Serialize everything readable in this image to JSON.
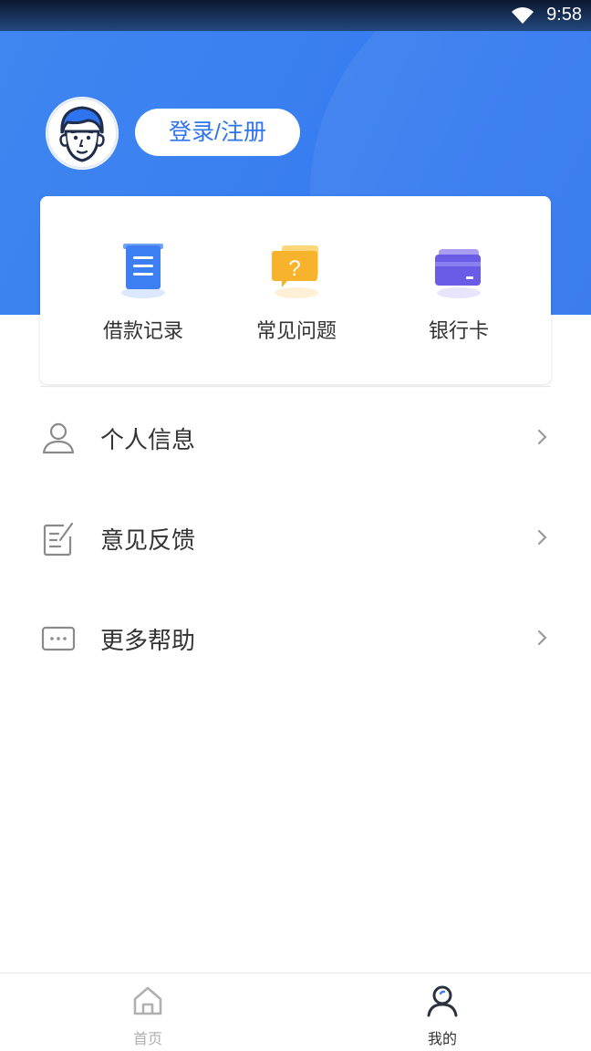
{
  "status_bar": {
    "time": "9:58"
  },
  "profile": {
    "login_label": "登录/注册"
  },
  "quick_actions": [
    {
      "label": "借款记录",
      "icon": "document-icon",
      "color": "#3d7ff3"
    },
    {
      "label": "常见问题",
      "icon": "question-bubble-icon",
      "color": "#f7b32b"
    },
    {
      "label": "银行卡",
      "icon": "bank-card-icon",
      "color": "#6a5ce6"
    }
  ],
  "menu": [
    {
      "label": "个人信息",
      "icon": "user-icon"
    },
    {
      "label": "意见反馈",
      "icon": "edit-note-icon"
    },
    {
      "label": "更多帮助",
      "icon": "more-help-icon"
    }
  ],
  "tab_bar": {
    "tabs": [
      {
        "label": "首页",
        "icon": "home-icon",
        "active": false
      },
      {
        "label": "我的",
        "icon": "profile-icon",
        "active": true
      }
    ]
  },
  "colors": {
    "brand": "#3a7ff0",
    "active_tab": "#333333",
    "inactive_tab": "#b0b0b0"
  }
}
